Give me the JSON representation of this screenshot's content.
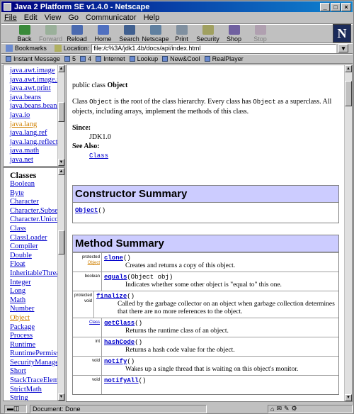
{
  "window": {
    "title": "Java 2 Platform SE v1.4.0 - Netscape"
  },
  "menu": [
    "File",
    "Edit",
    "View",
    "Go",
    "Communicator",
    "Help"
  ],
  "toolbar": [
    {
      "label": "Back",
      "icon": "back-icon",
      "color": "#3a8a3a",
      "disabled": false
    },
    {
      "label": "Forward",
      "icon": "forward-icon",
      "color": "#9ab09a",
      "disabled": true
    },
    {
      "label": "Reload",
      "icon": "reload-icon",
      "color": "#4a6ab0",
      "disabled": false
    },
    {
      "label": "Home",
      "icon": "home-icon",
      "color": "#5070c0",
      "disabled": false
    },
    {
      "label": "Search",
      "icon": "search-icon",
      "color": "#406090",
      "disabled": false
    },
    {
      "label": "Netscape",
      "icon": "netscape-icon",
      "color": "#6080a0",
      "disabled": false
    },
    {
      "label": "Print",
      "icon": "print-icon",
      "color": "#8090a0",
      "disabled": false
    },
    {
      "label": "Security",
      "icon": "lock-icon",
      "color": "#a0a060",
      "disabled": false
    },
    {
      "label": "Shop",
      "icon": "shop-icon",
      "color": "#7060a0",
      "disabled": false
    },
    {
      "label": "Stop",
      "icon": "stop-icon",
      "color": "#b0a0b0",
      "disabled": true
    }
  ],
  "location": {
    "bookmarks": "Bookmarks",
    "label": "Location:",
    "url": "file:/c%3A/jdk1.4b/docs/api/index.html"
  },
  "personal": [
    "Instant Message",
    "5",
    "4",
    "Internet",
    "Lookup",
    "New&Cool",
    "RealPlayer"
  ],
  "packages": [
    "java.awt.image",
    "java.awt.image.re",
    "java.awt.print",
    "java.beans",
    "java.beans.beanc",
    "java.io",
    "java.lang",
    "java.lang.ref",
    "java.lang.reflect",
    "java.math",
    "java.net"
  ],
  "visited_package": "java.lang",
  "classes_header": "Classes",
  "classes": [
    "Boolean",
    "Byte",
    "Character",
    "Character.Subset",
    "Character.Unico",
    "Class",
    "ClassLoader",
    "Compiler",
    "Double",
    "Float",
    "InheritableThrea",
    "Integer",
    "Long",
    "Math",
    "Number",
    "Object",
    "Package",
    "Process",
    "Runtime",
    "RuntimePermissio",
    "SecurityManager",
    "Short",
    "StackTraceEleme",
    "StrictMath",
    "String"
  ],
  "visited_class": "Object",
  "main": {
    "decl_pre": "public class ",
    "decl_name": "Object",
    "desc_pre": "Class ",
    "desc_code": "Object",
    "desc_mid": " is the root of the class hierarchy. Every class has ",
    "desc_code2": "Object",
    "desc_post": " as a superclass. All objects, including arrays, implement the methods of this class.",
    "since_label": "Since:",
    "since_val": "JDK1.0",
    "seealso_label": "See Also:",
    "seealso_link": "Class",
    "ctor_title": "Constructor Summary",
    "ctor_name": "Object",
    "ctor_args": "()",
    "method_title": "Method Summary",
    "methods": [
      {
        "mod1": "protected",
        "mod2": "Object",
        "name": "clone",
        "args": "()",
        "desc": "Creates and returns a copy of this object."
      },
      {
        "mod1": "boolean",
        "mod2": "",
        "name": "equals",
        "args": "(Object obj)",
        "desc": "Indicates whether some other object is \"equal to\" this one."
      },
      {
        "mod1": "protected",
        "mod2": "void",
        "name": "finalize",
        "args": "()",
        "desc": "Called by the garbage collector on an object when garbage collection determines that there are no more references to the object."
      },
      {
        "mod1": "Class",
        "mod2": "",
        "name": "getClass",
        "args": "()",
        "desc": "Returns the runtime class of an object."
      },
      {
        "mod1": "int",
        "mod2": "",
        "name": "hashCode",
        "args": "()",
        "desc": "Returns a hash code value for the object."
      },
      {
        "mod1": "void",
        "mod2": "",
        "name": "notify",
        "args": "()",
        "desc": "Wakes up a single thread that is waiting on this object's monitor."
      },
      {
        "mod1": "void",
        "mod2": "",
        "name": "notifyAll",
        "args": "()",
        "desc": ""
      }
    ]
  },
  "status": {
    "text": "Document: Done"
  }
}
